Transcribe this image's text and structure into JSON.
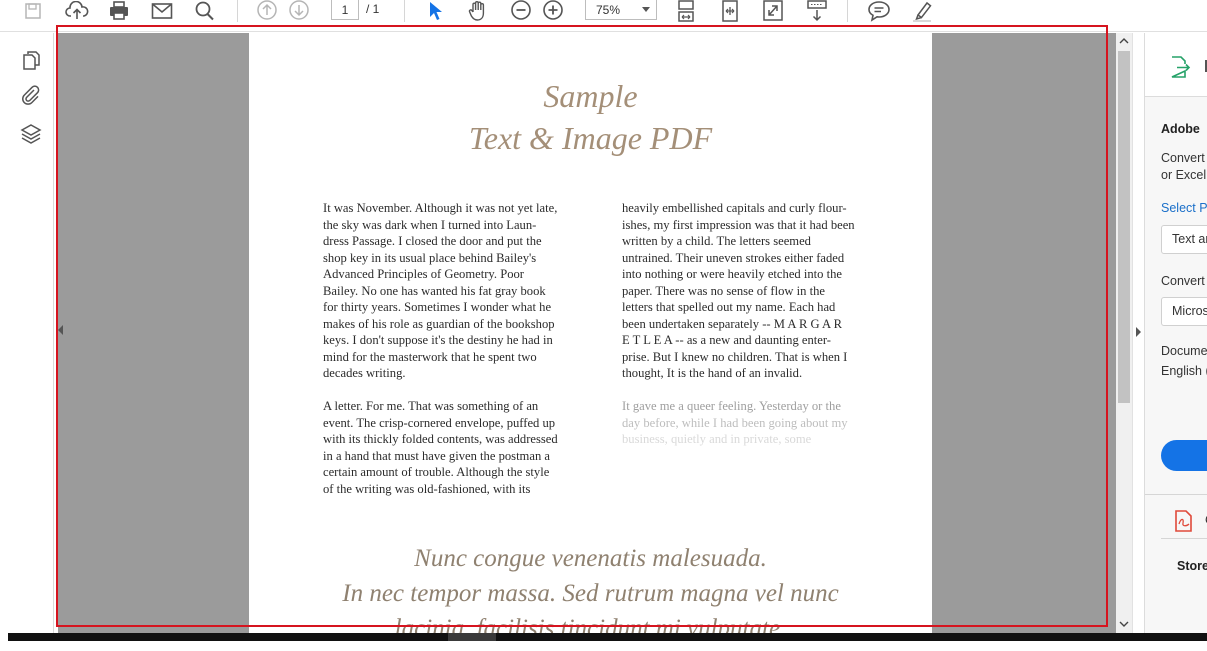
{
  "toolbar": {
    "icons": [
      "save-icon",
      "upload-cloud-icon",
      "print-icon",
      "email-icon",
      "search-icon",
      "page-up-icon",
      "page-down-icon",
      "select-cursor-icon",
      "hand-icon",
      "zoom-out-icon",
      "zoom-in-icon",
      "fit-page-icon",
      "fit-width-icon",
      "full-screen-icon",
      "scrolling-mode-icon",
      "comment-icon",
      "highlight-icon"
    ],
    "page_current": "1",
    "page_total": "/ 1",
    "zoom": "75%",
    "accent_color": "#1473e6"
  },
  "left_pane": {
    "icons": [
      "pages-icon",
      "attachment-icon",
      "layers-icon"
    ]
  },
  "document": {
    "title_line1": "Sample",
    "title_line2": "Text & Image PDF",
    "col1_para1": [
      "It was November. Although it was not yet late,",
      "the sky was dark when I turned into Laun-",
      "dress Passage. I closed the door and put the",
      "shop key in its usual place behind Bailey's",
      "Advanced Principles of Geometry. Poor",
      "Bailey. No one has wanted his fat gray book",
      "for thirty years. Sometimes I wonder what he",
      "makes of his role as guardian of the bookshop",
      "keys. I don't suppose it's the destiny he had in",
      "mind for the masterwork that he spent two",
      "decades writing."
    ],
    "col1_para2": [
      "A letter. For me. That was something of an",
      "event. The crisp-cornered envelope, puffed up",
      "with its thickly folded contents, was addressed",
      "in a hand that must have given the postman a",
      "certain amount of trouble. Although the style",
      "of the writing was old-fashioned, with its"
    ],
    "col2_para1": [
      "heavily embellished capitals and curly flour-",
      "ishes, my first impression was that it had been",
      "written by a child. The letters seemed",
      "untrained. Their uneven strokes either faded",
      "into nothing or were heavily etched into the",
      "paper. There was no sense of flow in the",
      "letters that spelled out my name. Each had",
      "been undertaken separately -- M A R G A R",
      "E T L E A -- as a new and daunting enter-",
      "prise. But I knew no children. That is when I",
      "thought, It is the hand of an invalid."
    ],
    "col2_para2": [
      "It gave me a queer feeling. Yesterday or the",
      "day before, while I had been going about my",
      "business, quietly and in private, some"
    ],
    "quote_lines": [
      "Nunc congue venenatis malesuada.",
      "In nec tempor massa. Sed rutrum magna vel nunc",
      "lacinia, facilisis tincidunt mi vulputate."
    ],
    "title_color": "#a48f78"
  },
  "right_pane": {
    "export_icon": "export-pdf-icon",
    "heading": "Adobe",
    "desc_line1": "Convert",
    "desc_line2": "or Excel",
    "select_label": "Select P",
    "select_value": "Text ar",
    "convert_label": "Convert",
    "convert_value": "Micros",
    "doc_lang_label": "Docume",
    "doc_lang_value": "English (",
    "create_icon": "create-pdf-icon",
    "create_label": "C",
    "store_label": "Store"
  }
}
